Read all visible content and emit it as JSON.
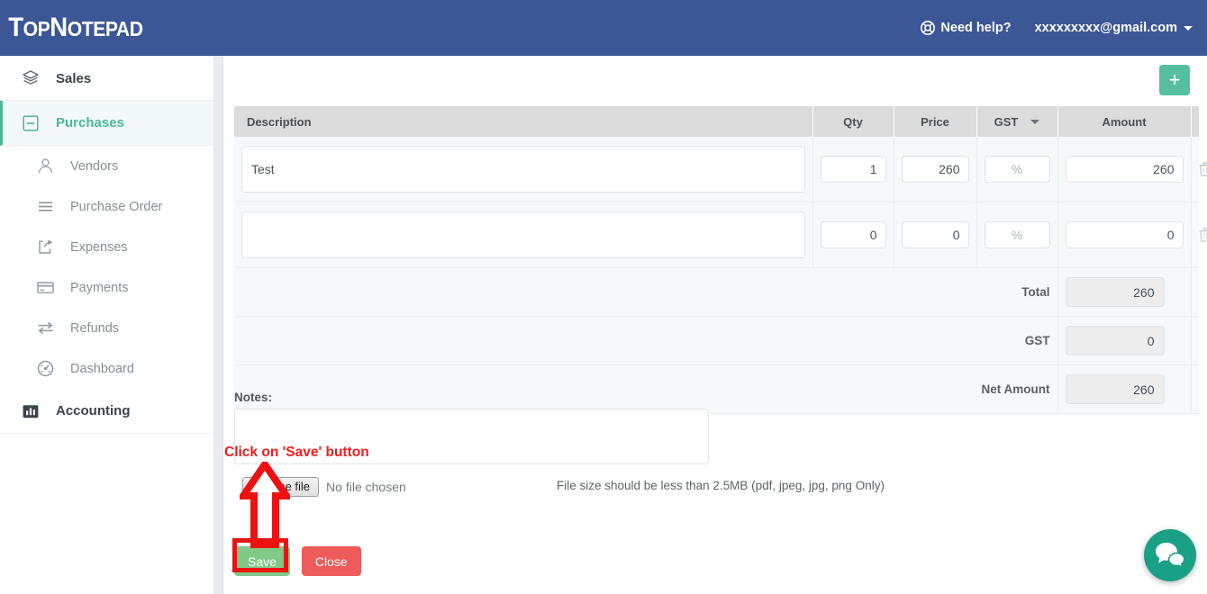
{
  "header": {
    "brand_top": "Top",
    "brand_note": "Notepad",
    "help_label": "Need help?",
    "help_icon": "life-ring-icon",
    "user_email": "xxxxxxxxx@gmail.com",
    "caret_icon": "caret-down-icon",
    "bg_color": "#3b5795"
  },
  "sidebar": {
    "groups": [
      {
        "label": "Sales",
        "icon": "layers-icon",
        "active": false
      },
      {
        "label": "Purchases",
        "icon": "minus-square-icon",
        "active": true
      },
      {
        "label": "Accounting",
        "icon": "bar-chart-icon",
        "active": false
      }
    ],
    "items": [
      {
        "label": "Vendors",
        "icon": "user-icon"
      },
      {
        "label": "Purchase Order",
        "icon": "list-icon"
      },
      {
        "label": "Expenses",
        "icon": "share-icon"
      },
      {
        "label": "Payments",
        "icon": "credit-card-icon"
      },
      {
        "label": "Refunds",
        "icon": "exchange-icon"
      },
      {
        "label": "Dashboard",
        "icon": "gauge-icon"
      }
    ],
    "active_color": "#49b996"
  },
  "main": {
    "add_row_button": "+",
    "add_row_icon": "plus-icon",
    "accent_color": "#55bfa0",
    "table": {
      "columns": [
        "Description",
        "Qty",
        "Price",
        "GST",
        "Amount"
      ],
      "gst_dropdown_icon": "chevron-down-icon",
      "gst_placeholder": "%",
      "delete_icon": "trash-icon",
      "rows": [
        {
          "description": "Test",
          "qty": "1",
          "price": "260",
          "gst": "",
          "amount": "260"
        },
        {
          "description": "",
          "qty": "0",
          "price": "0",
          "gst": "",
          "amount": "0"
        }
      ],
      "totals": [
        {
          "label": "Total",
          "value": "260"
        },
        {
          "label": "GST",
          "value": "0"
        },
        {
          "label": "Net Amount",
          "value": "260"
        }
      ]
    },
    "notes_label": "Notes:",
    "notes_value": "",
    "file": {
      "choose_button": "Choose file",
      "status": "No file chosen",
      "hint": "File size should be less than 2.5MB (pdf, jpeg, jpg, png Only)"
    },
    "buttons": {
      "save": "Save",
      "save_color": "#80c987",
      "close": "Close",
      "close_color": "#ed5b5b"
    }
  },
  "annotation": {
    "text": "Click on 'Save' button",
    "color": "#f41c1c",
    "arrow_icon": "up-arrow-icon",
    "highlight_icon": "rectangle-highlight"
  },
  "chat": {
    "icon": "chat-bubbles-icon",
    "color": "#1aa086"
  }
}
